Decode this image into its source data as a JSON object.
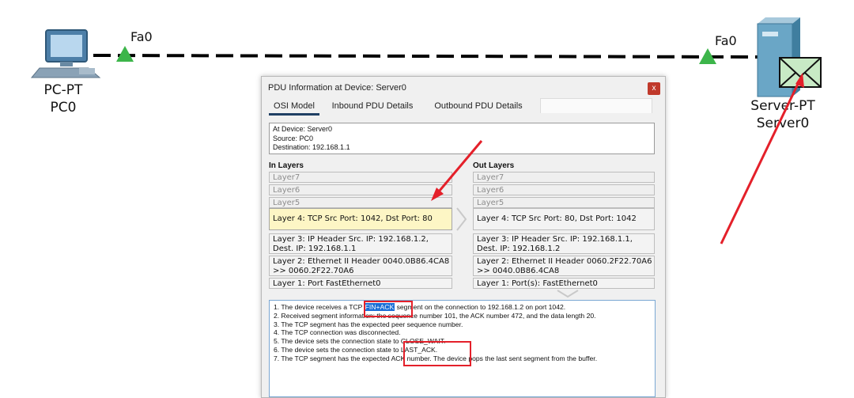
{
  "topology": {
    "pc": {
      "type_label": "PC-PT",
      "name_label": "PC0",
      "port_label": "Fa0"
    },
    "server": {
      "type_label": "Server-PT",
      "name_label": "Server0",
      "port_label": "Fa0"
    }
  },
  "dialog": {
    "title": "PDU Information at Device: Server0",
    "close_label": "x",
    "tabs": [
      "OSI Model",
      "Inbound PDU Details",
      "Outbound PDU Details"
    ],
    "info": {
      "device": "At Device: Server0",
      "source": "Source: PC0",
      "destination": "Destination: 192.168.1.1"
    },
    "in_layers": {
      "heading": "In Layers",
      "layer7": "Layer7",
      "layer6": "Layer6",
      "layer5": "Layer5",
      "layer4": "Layer 4: TCP Src Port: 1042, Dst Port: 80",
      "layer3": "Layer 3: IP Header Src. IP: 192.168.1.2, Dest. IP: 192.168.1.1",
      "layer2": "Layer 2: Ethernet II Header 0040.0B86.4CA8 >> 0060.2F22.70A6",
      "layer1": "Layer 1: Port FastEthernet0"
    },
    "out_layers": {
      "heading": "Out Layers",
      "layer7": "Layer7",
      "layer6": "Layer6",
      "layer5": "Layer5",
      "layer4": "Layer 4: TCP Src Port: 80, Dst Port: 1042",
      "layer3": "Layer 3: IP Header Src. IP: 192.168.1.1, Dest. IP: 192.168.1.2",
      "layer2": "Layer 2: Ethernet II Header 0060.2F22.70A6 >> 0040.0B86.4CA8",
      "layer1": "Layer 1: Port(s): FastEthernet0"
    },
    "description": {
      "line1_a": "1. The device receives a TCP ",
      "line1_hl": "FIN+ACK",
      "line1_b": " segment on the connection to 192.168.1.2 on port 1042.",
      "line2": "2. Received segment information: the sequence number 101, the ACK number 472, and the data length 20.",
      "line3": "3. The TCP segment has the expected peer sequence number.",
      "line4": "4. The TCP connection was disconnected.",
      "line5": "5. The device sets the connection state to CLOSE_WAIT.",
      "line6": "6. The device sets the connection state to LAST_ACK.",
      "line7": "7. The TCP segment has the expected ACK number. The device pops the last sent segment from the buffer."
    }
  },
  "colors": {
    "annotation_red": "#e4202a",
    "highlight_blue": "#1a6dd6",
    "layer_highlight": "#fdf6c5",
    "link_green": "#3cb54a"
  }
}
